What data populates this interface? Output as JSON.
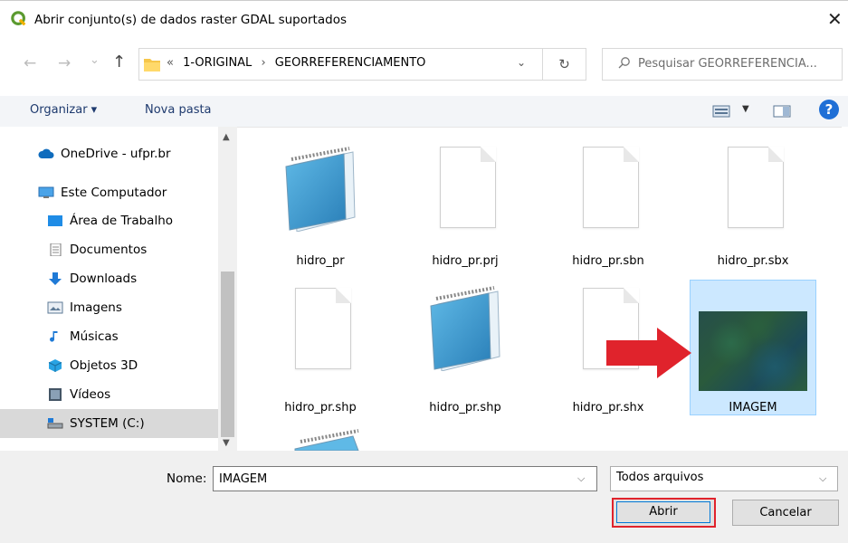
{
  "window": {
    "title": "Abrir conjunto(s) de dados raster GDAL suportados",
    "close_glyph": "✕"
  },
  "address": {
    "back_glyph": "←",
    "forward_glyph": "→",
    "dropdown_glyph": "⌄",
    "up_glyph": "↑",
    "breadcrumb": [
      "«",
      "1-ORIGINAL",
      "›",
      "GEORREFERENCIAMENTO"
    ],
    "refresh_glyph": "↻",
    "search_placeholder": "Pesquisar GEORREFERENCIA..."
  },
  "toolbar": {
    "organize": "Organizar ▾",
    "new_folder": "Nova pasta",
    "help": "?"
  },
  "nav": {
    "items": [
      {
        "label": "OneDrive - ufpr.br",
        "icon": "cloud-icon"
      },
      {
        "label": "Este Computador",
        "icon": "computer-icon"
      },
      {
        "label": "Área de Trabalho",
        "icon": "desktop-icon"
      },
      {
        "label": "Documentos",
        "icon": "document-icon"
      },
      {
        "label": "Downloads",
        "icon": "download-icon"
      },
      {
        "label": "Imagens",
        "icon": "image-icon"
      },
      {
        "label": "Músicas",
        "icon": "music-icon"
      },
      {
        "label": "Objetos 3D",
        "icon": "cube-icon"
      },
      {
        "label": "Vídeos",
        "icon": "video-icon"
      },
      {
        "label": "SYSTEM (C:)",
        "icon": "drive-icon",
        "selected": true
      }
    ]
  },
  "files": [
    {
      "name": "hidro_pr",
      "icon": "notepad-icon"
    },
    {
      "name": "hidro_pr.prj",
      "icon": "blank-file-icon"
    },
    {
      "name": "hidro_pr.sbn",
      "icon": "blank-file-icon"
    },
    {
      "name": "hidro_pr.sbx",
      "icon": "blank-file-icon"
    },
    {
      "name": "hidro_pr.shp",
      "icon": "blank-file-icon"
    },
    {
      "name": "hidro_pr.shp",
      "icon": "notepad-icon"
    },
    {
      "name": "hidro_pr.shx",
      "icon": "blank-file-icon"
    },
    {
      "name": "IMAGEM",
      "icon": "raster-thumbnail-icon",
      "selected": true
    }
  ],
  "bottom": {
    "name_label": "Nome:",
    "name_value": "IMAGEM",
    "filter_value": "Todos arquivos",
    "open_button": "Abrir",
    "cancel_button": "Cancelar"
  },
  "colors": {
    "accent": "#0078d7",
    "highlight": "#e0232c",
    "selection": "#cce8ff"
  }
}
